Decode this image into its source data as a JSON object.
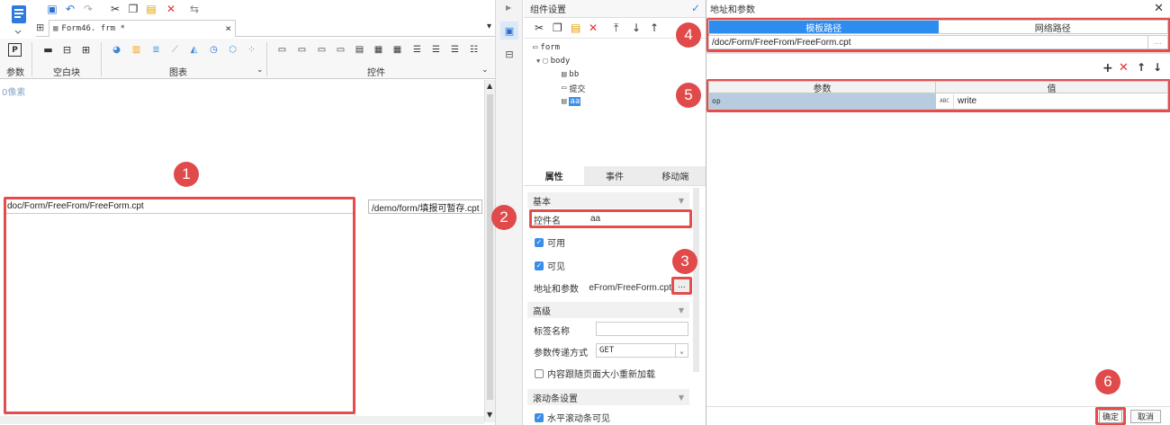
{
  "editor": {
    "tab_title": "Form46. frm *",
    "ribbon": {
      "group_param": "参数",
      "group_blank": "空白块",
      "group_chart": "图表",
      "group_widget": "控件"
    },
    "canvas_ruler_label": "0像素",
    "frame_url": "doc/Form/FreeFrom/FreeForm.cpt",
    "right_field_value": "/demo/form/填报可暂存.cpt"
  },
  "widget_settings": {
    "title": "组件设置",
    "tree": {
      "root": "form",
      "body": "body",
      "children": [
        "bb",
        "提交",
        "aa"
      ]
    },
    "tabs": [
      "属性",
      "事件",
      "移动端"
    ],
    "section_basic": "基本",
    "widget_name_label": "控件名",
    "widget_name_value": "aa",
    "enabled_label": "可用",
    "visible_label": "可见",
    "address_label": "地址和参数",
    "address_value": "eFrom/FreeForm.cpt",
    "address_btn": "...",
    "section_advanced": "高级",
    "tag_name_label": "标签名称",
    "param_method_label": "参数传递方式",
    "param_method_value": "GET",
    "reload_label": "内容跟随页面大小重新加载",
    "section_scroll": "滚动条设置",
    "hscroll_label": "水平滚动条可见"
  },
  "dialog": {
    "title": "地址和参数",
    "tab_template": "模板路径",
    "tab_network": "网络路径",
    "path_value": "/doc/Form/FreeFrom/FreeForm.cpt",
    "path_btn": "...",
    "col_param": "参数",
    "col_value": "值",
    "row_param": "op",
    "row_value_type": "ABC",
    "row_value": "write",
    "ok_label": "确定",
    "cancel_label": "取消"
  },
  "badges": [
    "1",
    "2",
    "3",
    "4",
    "5",
    "6"
  ],
  "colors": {
    "highlight_red": "#e74c4c",
    "badge_red": "#e04a4a",
    "accent_blue": "#2d8cf0",
    "selected_row": "#b7ccdf"
  }
}
